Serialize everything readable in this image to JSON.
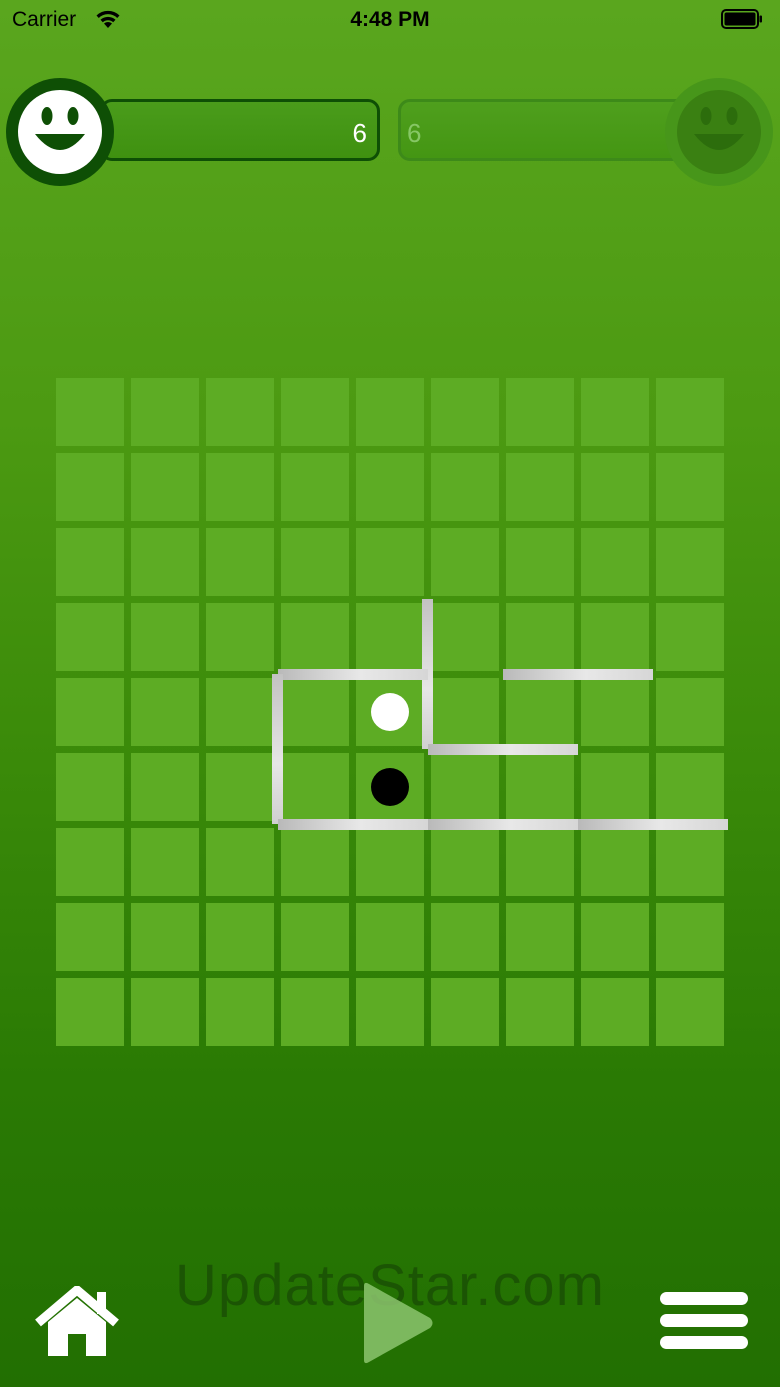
{
  "status_bar": {
    "carrier": "Carrier",
    "time": "4:48 PM",
    "icons": [
      "wifi-icon",
      "battery-icon"
    ]
  },
  "players": {
    "one": {
      "score": "6",
      "face_icon": "smiley-face-icon",
      "active": true
    },
    "two": {
      "score": "6",
      "face_icon": "smiley-face-icon",
      "active": false
    }
  },
  "board": {
    "size": 9,
    "pawns": [
      {
        "color": "white",
        "row": 4,
        "col": 4
      },
      {
        "color": "black",
        "row": 5,
        "col": 4
      }
    ],
    "walls": [
      {
        "orientation": "vertical",
        "row": 3,
        "col": 5,
        "length": 2
      },
      {
        "orientation": "horizontal",
        "row": 4,
        "col": 3,
        "length": 2
      },
      {
        "orientation": "horizontal",
        "row": 4,
        "col": 6,
        "length": 2
      },
      {
        "orientation": "vertical",
        "row": 4,
        "col": 3,
        "length": 2
      },
      {
        "orientation": "horizontal",
        "row": 5,
        "col": 5,
        "length": 2
      },
      {
        "orientation": "horizontal",
        "row": 6,
        "col": 3,
        "length": 2
      },
      {
        "orientation": "horizontal",
        "row": 6,
        "col": 5,
        "length": 2
      },
      {
        "orientation": "horizontal",
        "row": 6,
        "col": 7,
        "length": 2
      }
    ]
  },
  "watermark": "UpdateStar.com",
  "controls": {
    "home_icon": "home-icon",
    "play_icon": "play-icon",
    "menu_icon": "menu-icon"
  },
  "colors": {
    "background_top": "#5aa61e",
    "background_bottom": "#226f02",
    "cell": "#5dac24",
    "active_ring": "#0e4f05"
  }
}
